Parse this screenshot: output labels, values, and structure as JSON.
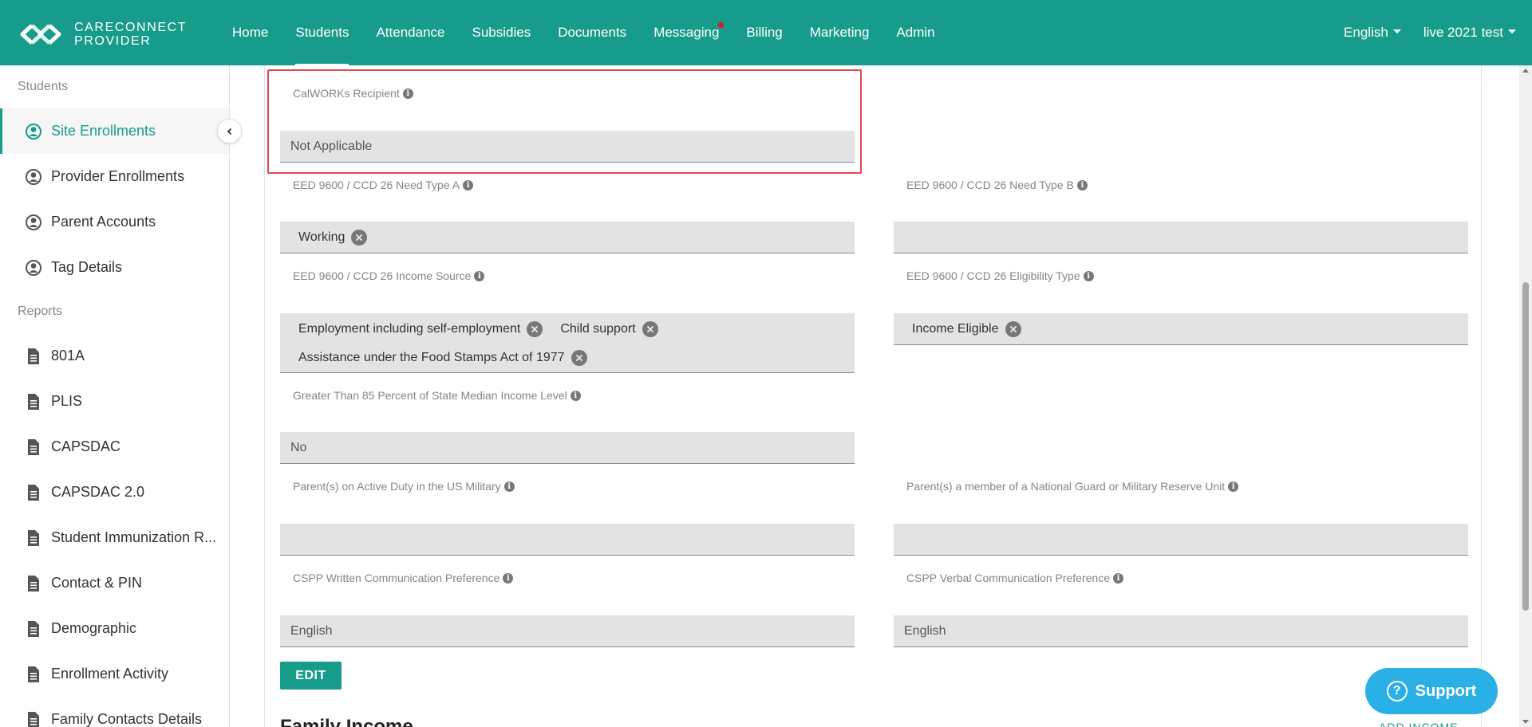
{
  "brand": {
    "line1": "CARECONNECT",
    "line2": "PROVIDER"
  },
  "nav": {
    "items": [
      {
        "label": "Home"
      },
      {
        "label": "Students"
      },
      {
        "label": "Attendance"
      },
      {
        "label": "Subsidies"
      },
      {
        "label": "Documents"
      },
      {
        "label": "Messaging"
      },
      {
        "label": "Billing"
      },
      {
        "label": "Marketing"
      },
      {
        "label": "Admin"
      }
    ],
    "active": "Students",
    "language": "English",
    "account": "live 2021 test"
  },
  "sidebar": {
    "students_heading": "Students",
    "students_items": [
      {
        "label": "Site Enrollments",
        "icon": "user-circle-icon"
      },
      {
        "label": "Provider Enrollments",
        "icon": "user-circle-icon"
      },
      {
        "label": "Parent Accounts",
        "icon": "user-circle-icon"
      },
      {
        "label": "Tag Details",
        "icon": "user-circle-icon"
      }
    ],
    "reports_heading": "Reports",
    "report_items": [
      {
        "label": "801A",
        "icon": "document-icon"
      },
      {
        "label": "PLIS",
        "icon": "document-icon"
      },
      {
        "label": "CAPSDAC",
        "icon": "document-icon"
      },
      {
        "label": "CAPSDAC 2.0",
        "icon": "document-icon"
      },
      {
        "label": "Student Immunization R...",
        "icon": "document-icon"
      },
      {
        "label": "Contact & PIN",
        "icon": "document-icon"
      },
      {
        "label": "Demographic",
        "icon": "document-icon"
      },
      {
        "label": "Enrollment Activity",
        "icon": "document-icon"
      },
      {
        "label": "Family Contacts Details",
        "icon": "document-icon"
      }
    ]
  },
  "form": {
    "calworks": {
      "label": "CalWORKs Recipient",
      "value": "Not Applicable"
    },
    "need_type_a": {
      "label": "EED 9600 / CCD 26 Need Type A",
      "chips": [
        "Working"
      ]
    },
    "need_type_b": {
      "label": "EED 9600 / CCD 26 Need Type B",
      "value": ""
    },
    "income_source": {
      "label": "EED 9600 / CCD 26 Income Source",
      "chips": [
        "Employment including self-employment",
        "Child support",
        "Assistance under the Food Stamps Act of 1977"
      ]
    },
    "eligibility_type": {
      "label": "EED 9600 / CCD 26 Eligibility Type",
      "chips": [
        "Income Eligible"
      ]
    },
    "smi": {
      "label": "Greater Than 85 Percent of State Median Income Level",
      "value": "No"
    },
    "active_duty": {
      "label": "Parent(s) on Active Duty in the US Military",
      "value": ""
    },
    "national_guard": {
      "label": "Parent(s) a member of a National Guard or Military Reserve Unit",
      "value": ""
    },
    "written_pref": {
      "label": "CSPP Written Communication Preference",
      "value": "English"
    },
    "verbal_pref": {
      "label": "CSPP Verbal Communication Preference",
      "value": "English"
    },
    "edit_label": "EDIT"
  },
  "family_income": {
    "title": "Family Income",
    "add_label": "ADD INCOME"
  },
  "support": {
    "label": "Support"
  },
  "colors": {
    "brand": "#179c8b",
    "highlight": "#e0474f",
    "support": "#2ab0e6"
  }
}
